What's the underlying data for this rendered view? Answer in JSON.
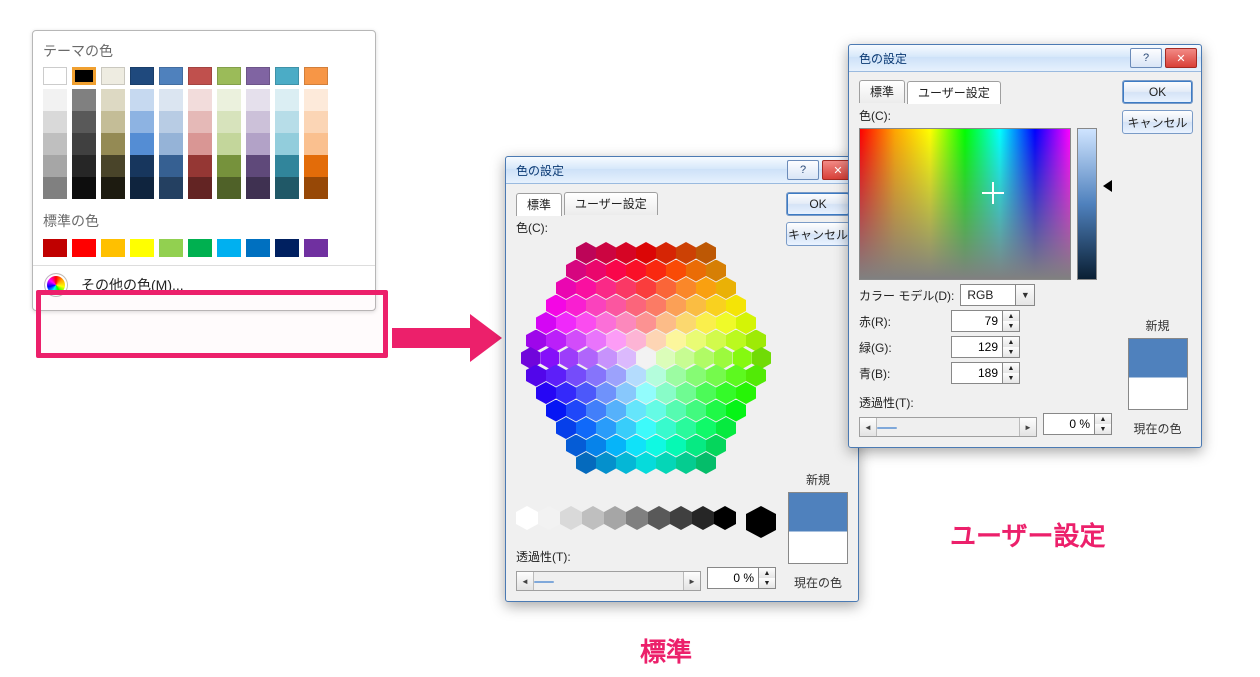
{
  "palette_panel": {
    "theme_title": "テーマの色",
    "standard_title": "標準の色",
    "more_colors_label": "その他の色(M)...",
    "theme_colors": [
      "#FFFFFF",
      "#000000",
      "#EEECE1",
      "#1F497D",
      "#4F81BD",
      "#C0504D",
      "#9BBB59",
      "#8064A2",
      "#4BACC6",
      "#F79646"
    ],
    "theme_tints": [
      [
        "#F2F2F2",
        "#D9D9D9",
        "#BFBFBF",
        "#A6A6A6",
        "#808080"
      ],
      [
        "#808080",
        "#595959",
        "#404040",
        "#262626",
        "#0D0D0D"
      ],
      [
        "#DDD9C3",
        "#C4BD97",
        "#948A54",
        "#494429",
        "#1D1B10"
      ],
      [
        "#C6D9F0",
        "#8DB3E2",
        "#548DD4",
        "#17365D",
        "#0F243E"
      ],
      [
        "#DBE5F1",
        "#B8CCE4",
        "#95B3D7",
        "#366092",
        "#244061"
      ],
      [
        "#F2DCDB",
        "#E5B9B7",
        "#D99694",
        "#953734",
        "#632423"
      ],
      [
        "#EBF1DD",
        "#D7E3BC",
        "#C3D69B",
        "#76923C",
        "#4F6128"
      ],
      [
        "#E5E0EC",
        "#CCC1D9",
        "#B2A2C7",
        "#5F497A",
        "#3F3151"
      ],
      [
        "#DBEEF3",
        "#B7DDE8",
        "#92CDDC",
        "#31859B",
        "#205867"
      ],
      [
        "#FDEADA",
        "#FBD5B5",
        "#FAC08F",
        "#E36C09",
        "#974806"
      ]
    ],
    "standard_colors": [
      "#C00000",
      "#FF0000",
      "#FFC000",
      "#FFFF00",
      "#92D050",
      "#00B050",
      "#00B0F0",
      "#0070C0",
      "#002060",
      "#7030A0"
    ],
    "selected_theme_index": 1
  },
  "dialog_common": {
    "title": "色の設定",
    "help_glyph": "?",
    "close_glyph": "✕",
    "ok_label": "OK",
    "cancel_label": "キャンセル",
    "tab_standard": "標準",
    "tab_custom": "ユーザー設定",
    "color_field_label": "色(C):",
    "transparency_label": "透過性(T):",
    "transparency_value": "0 %",
    "preview_new": "新規",
    "preview_current": "現在の色",
    "preview_color": "#4F81BD"
  },
  "standard_dialog": {
    "grayscale": [
      "#FFFFFF",
      "#F2F2F2",
      "#D9D9D9",
      "#BFBFBF",
      "#A6A6A6",
      "#808080",
      "#595959",
      "#404040",
      "#262626",
      "#000000"
    ],
    "big_swatch": "#000000"
  },
  "custom_dialog": {
    "model_label": "カラー モデル(D):",
    "model_value": "RGB",
    "red_label": "赤(R):",
    "green_label": "緑(G):",
    "blue_label": "青(B):",
    "red_value": "79",
    "green_value": "129",
    "blue_value": "189"
  },
  "annotations": {
    "standard": "標準",
    "custom": "ユーザー設定"
  }
}
